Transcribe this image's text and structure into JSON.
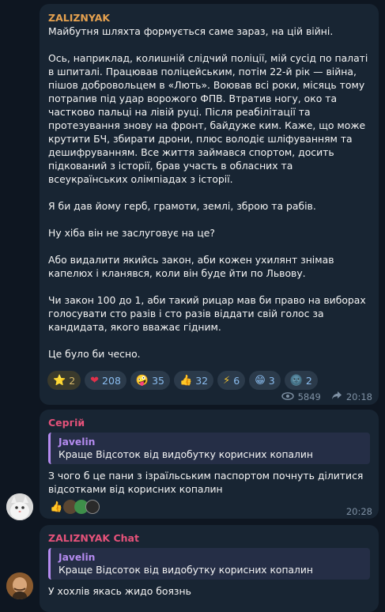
{
  "post": {
    "sender": "ZALIZNYAK",
    "sender_color": "#e5a14f",
    "paragraphs": [
      "Майбутня шляхта формується саме зараз, на цій війні.",
      "Ось, наприклад, колишній слідчий поліції, мій сусід по палаті в шпиталі. Працював поліцейським, потім 22-й рік — війна, пішов добровольцем в «Лють». Воював всі роки, місяць тому потрапив під удар ворожого ФПВ. Втратив ногу, око та частково пальці на лівій руці. Після реабілітації та протезування знову на фронт, байдуже ким. Каже, що може крутити БЧ, збирати дрони, плюс володіє шліфуванням та дешифруванням. Все життя займався спортом, досить підкований з історії, брав участь в обласних та всеукраїнських олімпіадах з історії.",
      "Я би дав йому герб, грамоти, землі, зброю та рабів.",
      "Ну хіба він не заслуговує на це?",
      "Або видалити якийсь закон, аби кожен ухилянт знімав капелюх і кланявся, коли він буде йти по Львову.",
      "Чи закон 100 до 1, аби такий рицар мав би право на виборах голосувати сто разів і сто разів віддати свій голос за кандидата, якого вважає гідним.",
      "Це було би чесно."
    ],
    "reactions": [
      {
        "emoji": "⭐",
        "count": "2",
        "icon": "star-icon"
      },
      {
        "emoji": "❤",
        "count": "208",
        "icon": "heart-icon"
      },
      {
        "emoji": "🤪",
        "count": "35",
        "icon": "crazy-face-icon"
      },
      {
        "emoji": "👍",
        "count": "32",
        "icon": "thumbs-up-icon"
      },
      {
        "emoji": "⚡",
        "count": "6",
        "icon": "lightning-icon"
      },
      {
        "emoji": "😁",
        "count": "3",
        "icon": "grin-icon"
      },
      {
        "emoji": "🌚",
        "count": "2",
        "icon": "dark-moon-icon"
      }
    ],
    "views": "5849",
    "time": "20:18"
  },
  "comment1": {
    "sender": "Сергій",
    "sender_color": "#e5527a",
    "reply_name": "Javelin",
    "reply_text": "Краще Відсоток від видобутку корисних копалин",
    "text": "З чого б це пани з ізраїльським паспортом почнуть ділитися відсотками від корисних копалин",
    "time": "20:28"
  },
  "comment2": {
    "sender": "ZALIZNYAK Chat",
    "sender_color": "#e5527a",
    "reply_name": "Javelin",
    "reply_text": "Краще Відсоток від видобутку корисних копалин",
    "text": "У хохлів якась жидо боязнь"
  },
  "colors": {
    "background": "#0e1621",
    "bubble": "#182533",
    "reply_accent": "#b58bf0",
    "reaction_chip": "#2b3a4a"
  }
}
